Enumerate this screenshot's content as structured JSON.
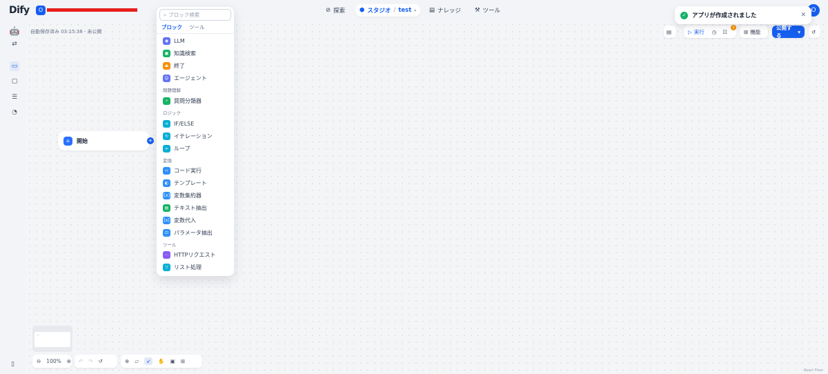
{
  "brand": {
    "logo_text": "Dify",
    "workspace_initial": "O"
  },
  "nav": {
    "explore": "探索",
    "studio": "スタジオ",
    "studio_app": "test",
    "knowledge": "ナレッジ",
    "tools": "ツール"
  },
  "toast": {
    "message": "アプリが作成されました"
  },
  "user": {
    "initial": "O"
  },
  "workflow": {
    "autosave": "自動保存済み 03:15:38 · 未公開",
    "run": "実行",
    "features": "機能",
    "publish": "公開する",
    "checklist_badge": "1"
  },
  "start_node": {
    "label": "開始"
  },
  "picker": {
    "search_placeholder": "ブロック検索",
    "tab_blocks": "ブロック",
    "tab_tools": "ツール",
    "items": [
      {
        "label": "LLM",
        "icon": "llm-icon",
        "color": "#6172f3"
      },
      {
        "label": "知識検索",
        "icon": "knowledge-retrieval-icon",
        "color": "#16b364"
      },
      {
        "label": "終了",
        "icon": "end-icon",
        "color": "#f79009"
      },
      {
        "label": "エージェント",
        "icon": "agent-icon",
        "color": "#6172f3"
      }
    ],
    "category_qa": "問題理解",
    "items_qa": [
      {
        "label": "質問分類器",
        "icon": "question-classifier-icon",
        "color": "#16b364"
      }
    ],
    "category_logic": "ロジック",
    "items_logic": [
      {
        "label": "IF/ELSE",
        "icon": "if-else-icon",
        "color": "#06aed4"
      },
      {
        "label": "イテレーション",
        "icon": "iteration-icon",
        "color": "#06aed4"
      },
      {
        "label": "ループ",
        "icon": "loop-icon",
        "color": "#06aed4"
      }
    ],
    "category_transform": "変換",
    "items_transform": [
      {
        "label": "コード実行",
        "icon": "code-icon",
        "color": "#2e90fa"
      },
      {
        "label": "テンプレート",
        "icon": "template-icon",
        "color": "#2e90fa"
      },
      {
        "label": "変数集約器",
        "icon": "variable-aggregator-icon",
        "color": "#2e90fa"
      },
      {
        "label": "テキスト抽出",
        "icon": "doc-extractor-icon",
        "color": "#16b364"
      },
      {
        "label": "変数代入",
        "icon": "variable-assigner-icon",
        "color": "#2e90fa"
      },
      {
        "label": "パラメータ抽出",
        "icon": "parameter-extractor-icon",
        "color": "#2e90fa"
      }
    ],
    "category_tools": "ツール",
    "items_tools": [
      {
        "label": "HTTPリクエスト",
        "icon": "http-icon",
        "color": "#875bf7"
      },
      {
        "label": "リスト処理",
        "icon": "list-operator-icon",
        "color": "#06aed4"
      }
    ]
  },
  "zoom": {
    "level": "100%"
  },
  "footer": {
    "react_flow": "React Flow"
  }
}
